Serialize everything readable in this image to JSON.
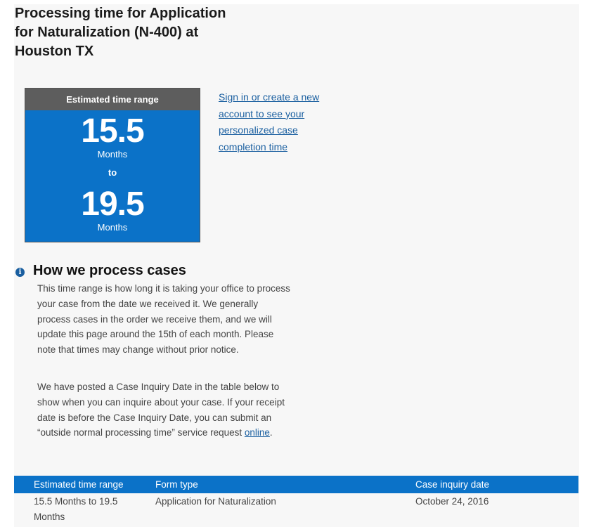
{
  "page": {
    "title": "Processing time for Application for Naturalization (N-400) at Houston TX"
  },
  "estimate_box": {
    "header": "Estimated time range",
    "min_value": "15.5",
    "min_unit": "Months",
    "separator": "to",
    "max_value": "19.5",
    "max_unit": "Months"
  },
  "signin_link": "Sign in or create a new account to see your personalized case completion time",
  "how_we_process": {
    "title": "How we process cases",
    "paragraph1": "This time range is how long it is taking your office to process your case from the date we received it. We generally process cases in the order we receive them, and we will update this page around the 15th of each month. Please note that times may change without prior notice.",
    "paragraph2_text": "We have posted a Case Inquiry Date in the table below to show when you can inquire about your case. If your receipt date is before the Case Inquiry Date, you can submit an “outside normal processing time” service request ",
    "paragraph2_link": "online",
    "paragraph2_end": "."
  },
  "table": {
    "headers": [
      "Estimated time range",
      "Form type",
      "Case inquiry date"
    ],
    "rows": [
      [
        "15.5 Months to 19.5 Months",
        "Application for Naturalization",
        "October 24, 2016"
      ]
    ]
  },
  "colors": {
    "primary_blue": "#0b72c8",
    "header_gray": "#5d5d5d",
    "link_blue": "#1a5fa0"
  },
  "icons": {
    "info": "info-icon"
  }
}
